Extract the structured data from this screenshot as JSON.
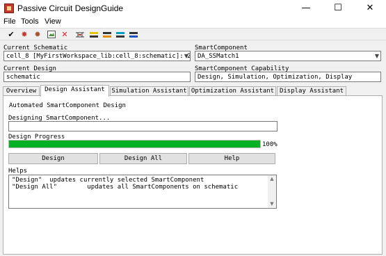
{
  "window": {
    "title": "Passive Circuit DesignGuide",
    "minimize": "—",
    "maximize": "☐",
    "close": "✕"
  },
  "menu": [
    "File",
    "Tools",
    "View"
  ],
  "toolbar": {
    "icons": [
      "check-icon",
      "gear-red-icon",
      "gear-multi-icon",
      "image-icon",
      "delete-x-icon",
      "circuit-icon",
      "align-yellow-icon",
      "align-orange-icon",
      "align-cyan-icon",
      "align-blue-icon"
    ],
    "colors": {
      "delete": "#e02020",
      "yellow": "#e8c400",
      "orange": "#e08a00",
      "cyan": "#00a0c0",
      "blue": "#2050c0"
    }
  },
  "fields": {
    "current_schematic_label": "Current Schematic",
    "current_schematic_value": "cell_8 [MyFirstWorkspace_lib:cell_8:schematic]: 2",
    "smart_component_label": "SmartComponent",
    "smart_component_value": "DA_SSMatch1",
    "current_design_label": "Current Design",
    "current_design_value": "schematic",
    "capability_label": "SmartComponent Capability",
    "capability_value": "Design, Simulation, Optimization, Display"
  },
  "tabs": [
    "Overview",
    "Design Assistant",
    "Simulation Assistant",
    "Optimization Assistant",
    "Display Assistant"
  ],
  "active_tab": "Design Assistant",
  "assistant": {
    "heading": "Automated SmartComponent Design",
    "designing_label": "Designing SmartComponent...",
    "designing_value": "",
    "progress_label": "Design Progress",
    "progress_percent_text": "100%",
    "progress_fraction": 1.0,
    "progress_color": "#06b025",
    "buttons": {
      "design": "Design",
      "design_all": "Design All",
      "help": "Help"
    },
    "helps_label": "Helps",
    "helps_lines": [
      "\"Design\"  updates currently selected SmartComponent",
      "\"Design All\"        updates all SmartComponents on schematic"
    ]
  }
}
